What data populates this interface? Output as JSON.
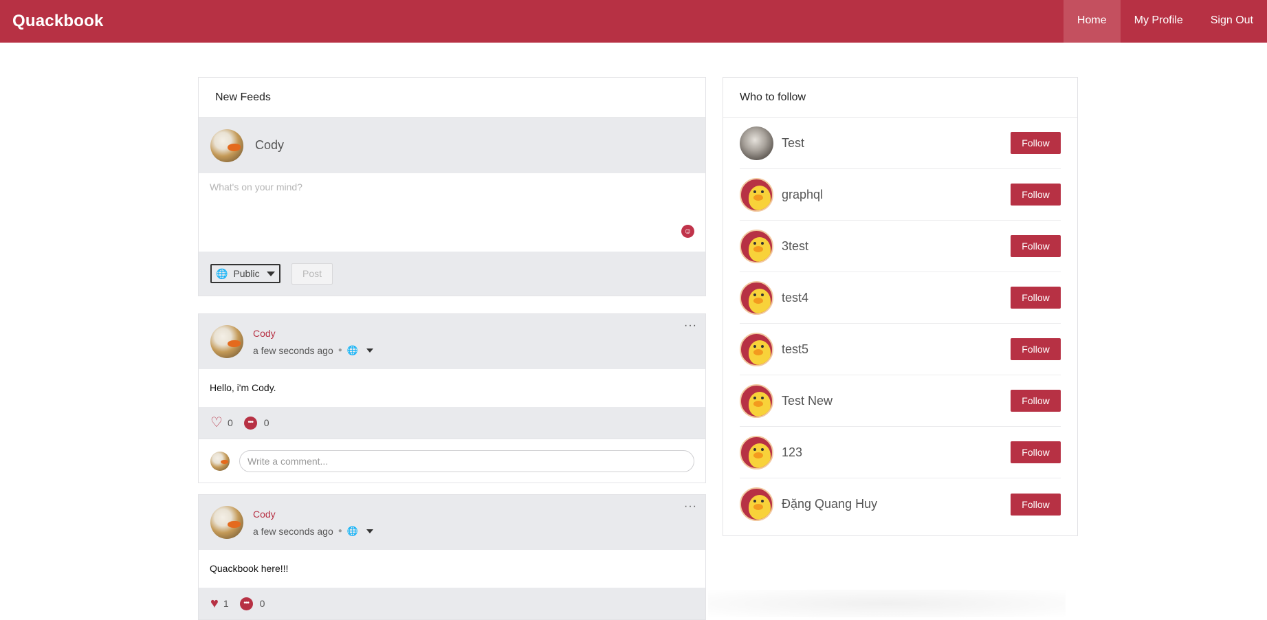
{
  "app": {
    "brand": "Quackbook",
    "nav": [
      {
        "label": "Home",
        "active": true
      },
      {
        "label": "My Profile",
        "active": false
      },
      {
        "label": "Sign Out",
        "active": false
      }
    ],
    "accent_color": "#b73144"
  },
  "feed": {
    "header": "New Feeds",
    "composer": {
      "user_name": "Cody",
      "placeholder": "What's on your mind?",
      "value": "",
      "privacy": "Public",
      "post_label": "Post",
      "emoji_icon": "smile-icon",
      "globe_icon": "globe-icon"
    },
    "posts": [
      {
        "author": "Cody",
        "time": "a few seconds ago",
        "content": "Hello, i'm Cody.",
        "likes": "0",
        "comments": "0",
        "liked": false,
        "comment_placeholder": "Write a comment..."
      },
      {
        "author": "Cody",
        "time": "a few seconds ago",
        "content": "Quackbook here!!!",
        "likes": "1",
        "comments": "0",
        "liked": true
      }
    ]
  },
  "who_to_follow": {
    "header": "Who to follow",
    "follow_label": "Follow",
    "users": [
      {
        "name": "Test",
        "avatar": "photo"
      },
      {
        "name": "graphql",
        "avatar": "duck"
      },
      {
        "name": "3test",
        "avatar": "duck"
      },
      {
        "name": "test4",
        "avatar": "duck"
      },
      {
        "name": "test5",
        "avatar": "duck"
      },
      {
        "name": "Test New",
        "avatar": "duck"
      },
      {
        "name": "123",
        "avatar": "duck"
      },
      {
        "name": "Đặng Quang Huy",
        "avatar": "duck"
      }
    ]
  }
}
